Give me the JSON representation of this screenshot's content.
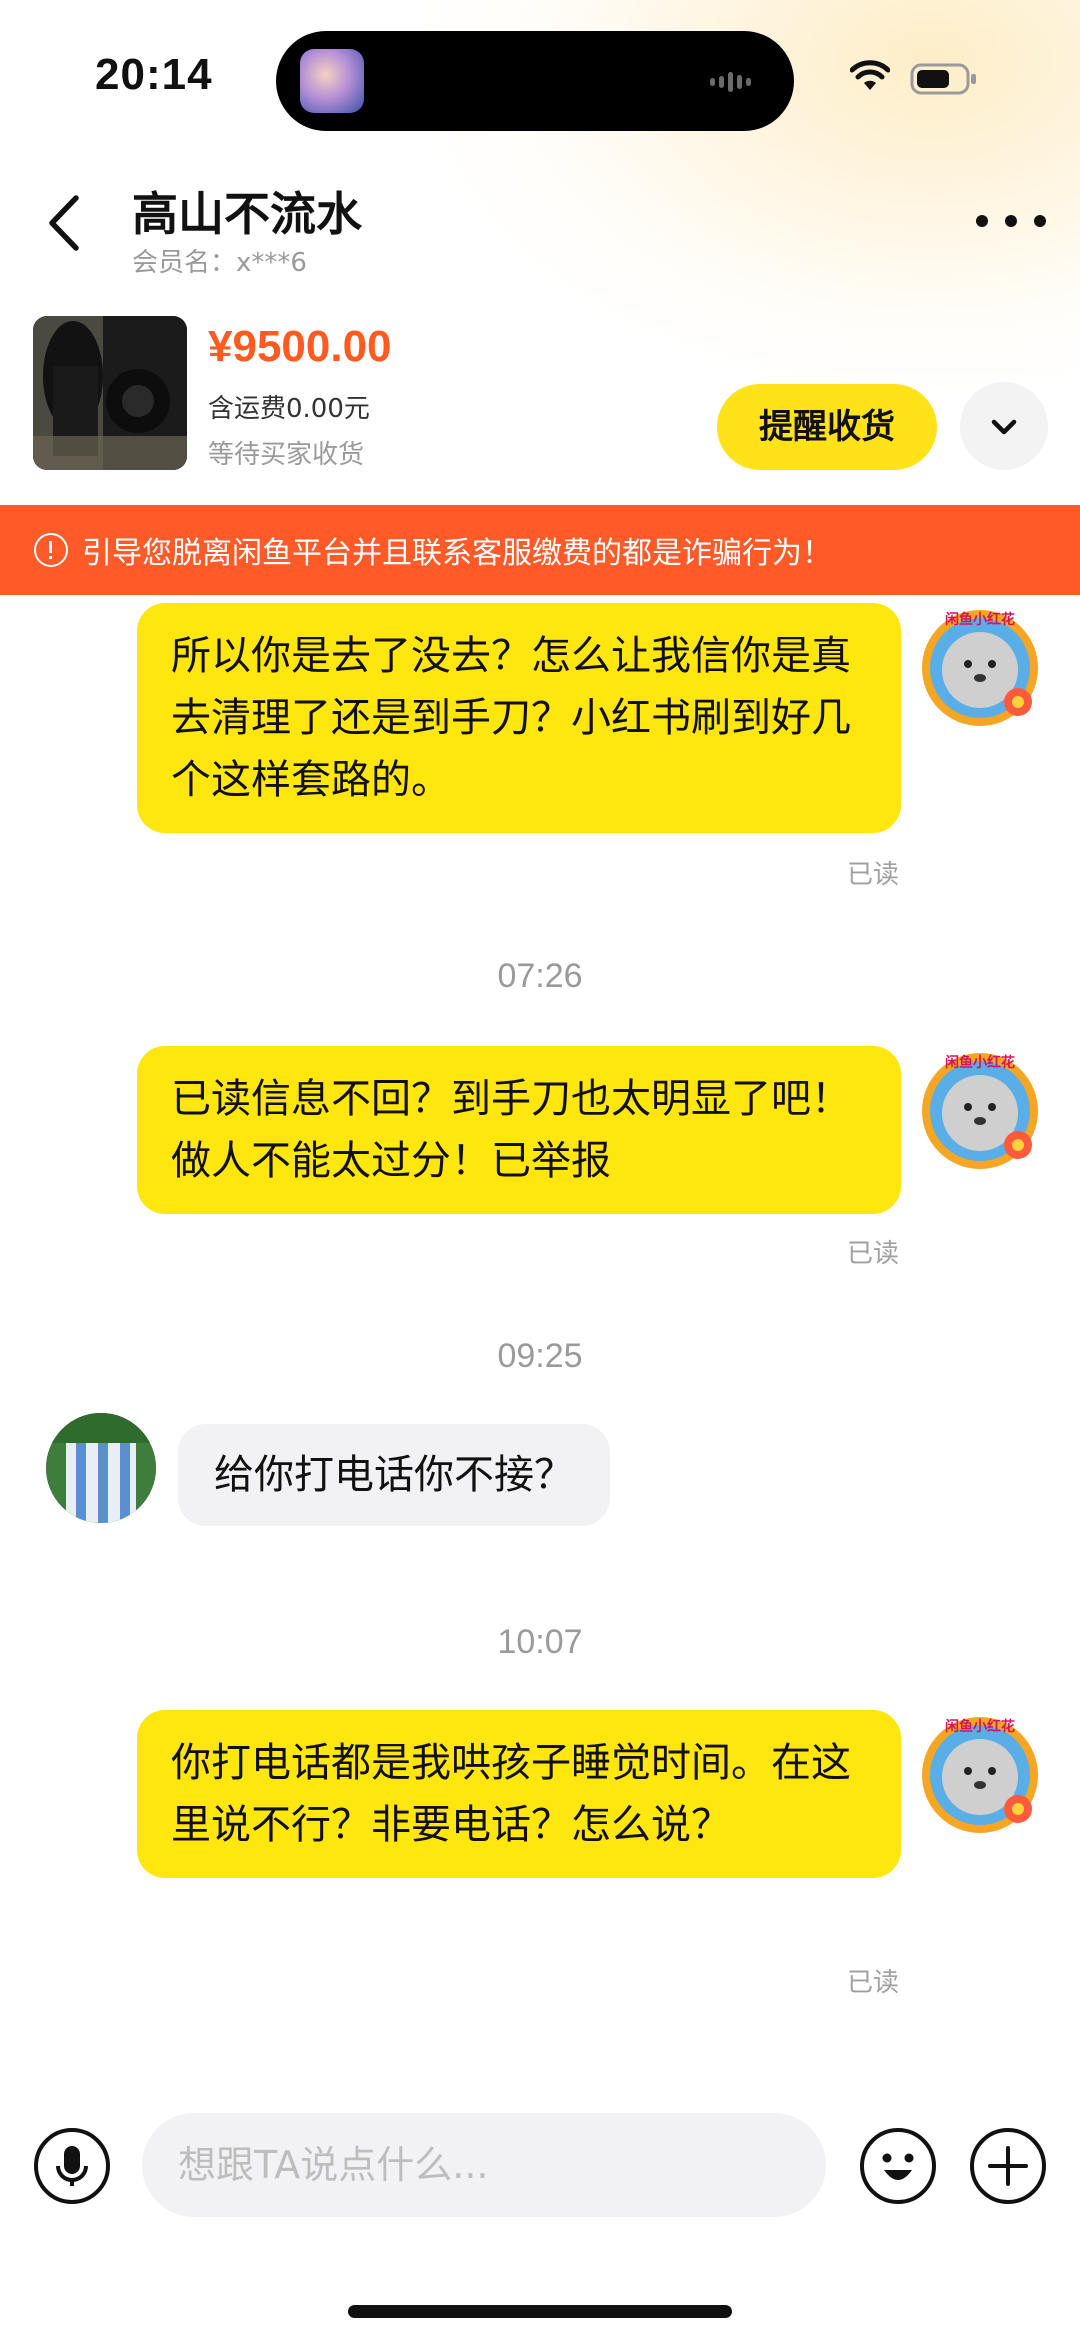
{
  "status_bar": {
    "time": "20:14"
  },
  "header": {
    "title": "高山不流水",
    "member_label": "会员名：x***6"
  },
  "product": {
    "price": "¥9500.00",
    "shipping": "含运费0.00元",
    "order_status": "等待买家收货",
    "remind_label": "提醒收货"
  },
  "warning": {
    "text": "引导您脱离闲鱼平台并且联系客服缴费的都是诈骗行为！"
  },
  "avatar_badge": "闲鱼小红花",
  "messages": [
    {
      "sender": "me",
      "text": "所以你是去了没去？怎么让我信你是真去清理了还是到手刀？小红书刷到好几个这样套路的。",
      "status": "已读"
    },
    {
      "timestamp": "07:26"
    },
    {
      "sender": "me",
      "text": "已读信息不回？到手刀也太明显了吧！做人不能太过分！已举报",
      "status": "已读"
    },
    {
      "timestamp": "09:25"
    },
    {
      "sender": "other",
      "text": "给你打电话你不接？"
    },
    {
      "timestamp": "10:07"
    },
    {
      "sender": "me",
      "text": "你打电话都是我哄孩子睡觉时间。在这里说不行？非要电话？怎么说？",
      "status": "已读"
    }
  ],
  "input": {
    "placeholder": "想跟TA说点什么..."
  },
  "colors": {
    "accent_yellow": "#ffe60f",
    "warning_orange": "#ff5a28",
    "price_orange": "#ff5a1f"
  }
}
